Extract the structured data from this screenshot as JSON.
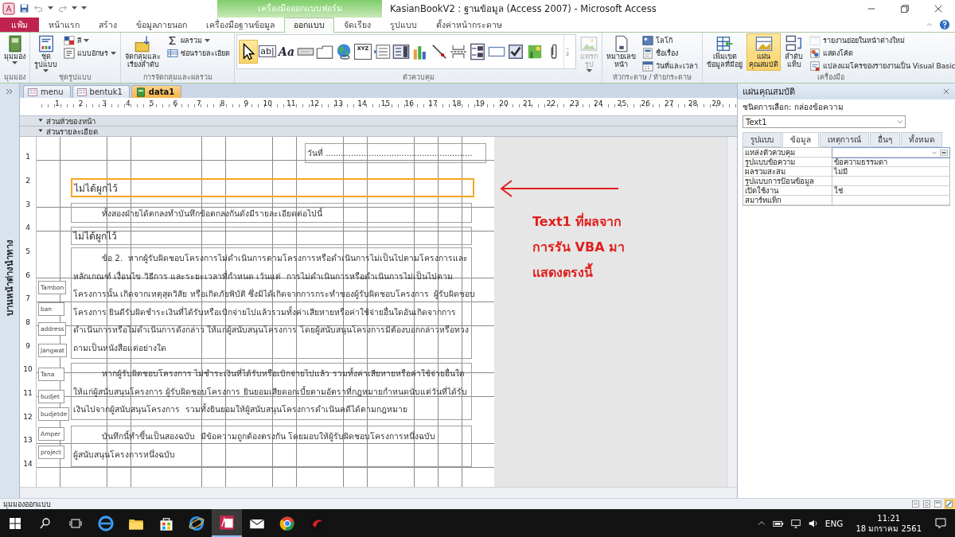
{
  "title_bar": {
    "context_tab_title": "เครื่องมือออกแบบฟอร์ม",
    "title": "KasianBookV2 : ฐานข้อมูล (Access 2007) - Microsoft Access"
  },
  "ribbon_tabs": [
    {
      "label": "แฟ้ม",
      "kind": "file",
      "selected": false
    },
    {
      "label": "หน้าแรก",
      "kind": "tab",
      "selected": false
    },
    {
      "label": "สร้าง",
      "kind": "tab",
      "selected": false
    },
    {
      "label": "ข้อมูลภายนอก",
      "kind": "tab",
      "selected": false
    },
    {
      "label": "เครื่องมือฐานข้อมูล",
      "kind": "tab",
      "selected": false
    },
    {
      "label": "ออกแบบ",
      "kind": "tab",
      "selected": true
    },
    {
      "label": "จัดเรียง",
      "kind": "tab",
      "selected": false
    },
    {
      "label": "รูปแบบ",
      "kind": "tab",
      "selected": false
    },
    {
      "label": "ตั้งค่าหน้ากระดาษ",
      "kind": "tab",
      "selected": false
    }
  ],
  "ribbon_groups": [
    {
      "label": "มุมมอง",
      "items": [
        {
          "kind": "large",
          "label": "มุมมอง",
          "caret": true,
          "selected": false,
          "disabled": false
        }
      ]
    },
    {
      "label": "ชุดรูปแบบ",
      "items": [
        {
          "kind": "large",
          "label": "ชุด\nรูปแบบ",
          "caret": true,
          "selected": false,
          "disabled": false
        },
        {
          "kind": "small",
          "label": "สี",
          "caret": true,
          "selected": false,
          "disabled": false
        },
        {
          "kind": "small",
          "label": "แบบอักษร",
          "caret": true,
          "selected": false,
          "disabled": false
        }
      ]
    },
    {
      "label": "การจัดกลุ่มและผลรวม",
      "items": [
        {
          "kind": "large",
          "label": "จัดกลุ่มและ\nเรียงลำดับ",
          "caret": false,
          "selected": false,
          "disabled": false
        },
        {
          "kind": "small",
          "label": "ผลรวม",
          "caret": true,
          "selected": false,
          "disabled": false
        },
        {
          "kind": "small",
          "label": "ซ่อนรายละเอียด",
          "caret": false,
          "selected": false,
          "disabled": false
        }
      ]
    },
    {
      "label": "ตัวควบคุม",
      "gallery": [
        {
          "selected": true
        },
        {
          "glyph": "ab|",
          "selected": false
        },
        {
          "glyph": "Aa",
          "selected": false
        },
        {
          "selected": false
        },
        {
          "selected": false
        },
        {
          "selected": false
        },
        {
          "glyph": "XYZ",
          "selected": false
        },
        {
          "selected": false
        },
        {
          "selected": false
        },
        {
          "selected": false
        },
        {
          "selected": false
        },
        {
          "selected": false
        },
        {
          "selected": false
        },
        {
          "selected": false
        },
        {
          "selected": false
        },
        {
          "selected": false
        },
        {
          "selected": false
        }
      ],
      "items": [
        {
          "kind": "large",
          "label": "แทรก\nรูป",
          "caret": true,
          "selected": false,
          "disabled": true
        }
      ]
    },
    {
      "label": "หัวกระดาษ / ท้ายกระดาษ",
      "items": [
        {
          "kind": "large",
          "label": "หมายเลข\nหน้า",
          "caret": false,
          "selected": false,
          "disabled": false
        },
        {
          "kind": "small",
          "label": "โลโก้",
          "caret": false,
          "selected": false,
          "disabled": false
        },
        {
          "kind": "small",
          "label": "ชื่อเรื่อง",
          "caret": false,
          "selected": false,
          "disabled": false
        },
        {
          "kind": "small",
          "label": "วันที่และเวลา",
          "caret": false,
          "selected": false,
          "disabled": false
        }
      ]
    },
    {
      "label": "เครื่องมือ",
      "items": [
        {
          "kind": "large",
          "label": "เพิ่มเขต\nข้อมูลที่มีอยู่",
          "caret": false,
          "selected": false,
          "disabled": false
        },
        {
          "kind": "large",
          "label": "แผ่น\nคุณสมบัติ",
          "caret": false,
          "selected": true,
          "disabled": false
        },
        {
          "kind": "large",
          "label": "ลำดับ\nแท็บ",
          "caret": false,
          "selected": false,
          "disabled": false
        },
        {
          "kind": "small",
          "label": "รายงานย่อยในหน้าต่างใหม่",
          "caret": false,
          "selected": false,
          "disabled": true
        },
        {
          "kind": "small",
          "label": "แสดงโค้ด",
          "caret": false,
          "selected": false,
          "disabled": false
        },
        {
          "kind": "small",
          "label": "แปลงแมโครของรายงานเป็น Visual Basic",
          "caret": false,
          "selected": false,
          "disabled": false
        }
      ]
    }
  ],
  "nav_pane": {
    "title": "บานหน้าต่างนำทาง"
  },
  "document_tabs": [
    {
      "label": "menu",
      "kind": "form",
      "selected": false
    },
    {
      "label": "bentuk1",
      "kind": "form",
      "selected": false
    },
    {
      "label": "data1",
      "kind": "report",
      "selected": true
    }
  ],
  "horizontal_ruler": [
    "1",
    "2",
    "3",
    "4",
    "5",
    "6",
    "7",
    "8",
    "9",
    "10",
    "11",
    "12",
    "13",
    "14",
    "15",
    "16",
    "17",
    "18",
    "19",
    "20",
    "21",
    "22",
    "23",
    "24",
    "25",
    "26",
    "27",
    "28",
    "29"
  ],
  "vertical_ruler": [
    "1",
    "2",
    "3",
    "4",
    "5",
    "6",
    "7",
    "8",
    "9",
    "10",
    "11",
    "12",
    "13",
    "14"
  ],
  "sections": [
    "ส่วนหัวของหน้า",
    "ส่วนรายละเอียด"
  ],
  "form_controls": [
    {
      "kind": "textbox",
      "text": "วันที่ ..........................................................",
      "selected": false
    },
    {
      "kind": "textbox",
      "text": "ไม่ได้ผูกไว้",
      "selected": true
    },
    {
      "kind": "paragraph",
      "text": "ทั้งสองฝ่ายได้ตกลงทำบันทึกข้อตกลงกันดังมีรายละเอียดต่อไปนี้",
      "selected": false
    },
    {
      "kind": "textbox",
      "text": "ไม่ได้ผูกไว้",
      "selected": false
    },
    {
      "kind": "paragraph",
      "text": "ข้อ 2.  หากผู้รับผิดชอบโครงการไม่ดำเนินการตามโครงการหรือดำเนินการไม่เป็นไปตามโครงการและ\nหลักเกณฑ์ เงื่อนไข วิธีการ และระยะเวลาที่กำหนด เว้นแต่  การไม่ดำเนินการหรือดำเนินการไม่เป็นไปตาม\nโครงการนั้น เกิดจากเหตุสุดวิสัย หรือเกิดภัยพิบัติ ซึ่งมิได้เกิดจากการกระทำของผู้รับผิดชอบโครงการ  ผู้รับผิดชอบ\nโครงการ ยินดีรับผิดชำระเงินที่ได้รับหรือเบิกจ่ายไปแล้วรวมทั้งค่าเสียหายหรือค่าใช้จ่ายอื่นใดอันเกิดจากการ\nดำเนินการหรือไม่ดำเนินการดังกล่าว ให้แก่ผู้สนับสนุนโครงการ โดยผู้สนับสนุนโครงการมิต้องบอกกล่าวหรือทวง\nถามเป็นหนังสือแต่อย่างใด",
      "selected": false
    },
    {
      "kind": "paragraph",
      "text": "หากผู้รับผิดชอบโครงการ ไม่ชำระเงินที่ได้รับหรือเบิกจ่ายไปแล้ว รวมทั้งค่าเสียหายหรือค่าใช้จ่ายอื่นใด\nให้แก่ผู้สนับสนุนโครงการ ผู้รับผิดชอบโครงการ ยินยอมเสียดอกเบี้ยตามอัตราที่กฎหมายกำหนดนับแต่วันที่ได้รับ\nเงินไปจากผู้สนับสนุนโครงการ  รวมทั้งยินยอมให้ผู้สนับสนุนโครงการดำเนินคดีได้ตามกฎหมาย",
      "selected": false
    },
    {
      "kind": "paragraph",
      "text": "บันทึกนี้ทำขึ้นเป็นสองฉบับ  มีข้อความถูกต้องตรงกัน โดยมอบให้ผู้รับผิดชอบโครงการหนึ่งฉบับ\nผู้สนับสนุนโครงการหนึ่งฉบับ",
      "selected": false
    }
  ],
  "field_labels": [
    "Tambon",
    "ban",
    "address",
    "Jangwat",
    "Tana",
    "budjet",
    "budjetde",
    "Amper",
    "project"
  ],
  "annotation": {
    "text": "Text1 ที่ผลจาก\nการรัน VBA มา\nแสดงตรงนี้"
  },
  "property_sheet": {
    "title": "แผ่นคุณสมบัติ",
    "selection_type": "ชนิดการเลือก: กล่องข้อความ",
    "object": "Text1",
    "tabs": [
      {
        "label": "รูปแบบ",
        "selected": false
      },
      {
        "label": "ข้อมูล",
        "selected": true
      },
      {
        "label": "เหตุการณ์",
        "selected": false
      },
      {
        "label": "อื่นๆ",
        "selected": false
      },
      {
        "label": "ทั้งหมด",
        "selected": false
      }
    ],
    "properties": [
      {
        "name": "แหล่งตัวควบคุม",
        "focused": true
      },
      {
        "name": "รูปแบบข้อความ",
        "value": "ข้อความธรรมดา",
        "focused": false
      },
      {
        "name": "ผลรวมสะสม",
        "value": "ไม่มี",
        "focused": false
      },
      {
        "name": "รูปแบบการป้อนข้อมูล",
        "focused": false
      },
      {
        "name": "เปิดใช้งาน",
        "value": "ใช่",
        "focused": false
      },
      {
        "name": "สมาร์ทแท็ก",
        "focused": false
      }
    ]
  },
  "status_bar": {
    "text": "มุมมองออกแบบ",
    "view_buttons": [
      {
        "selected": false
      },
      {
        "selected": false
      },
      {
        "selected": false
      },
      {
        "selected": true
      }
    ]
  },
  "taskbar": {
    "apps": [
      {
        "selected": false
      },
      {
        "selected": false
      },
      {
        "selected": false
      },
      {
        "selected": false
      },
      {
        "selected": true
      },
      {
        "selected": false
      },
      {
        "selected": false
      },
      {
        "selected": false
      }
    ],
    "language": "ENG",
    "time": "11:21",
    "date": "18 มกราคม 2561"
  }
}
